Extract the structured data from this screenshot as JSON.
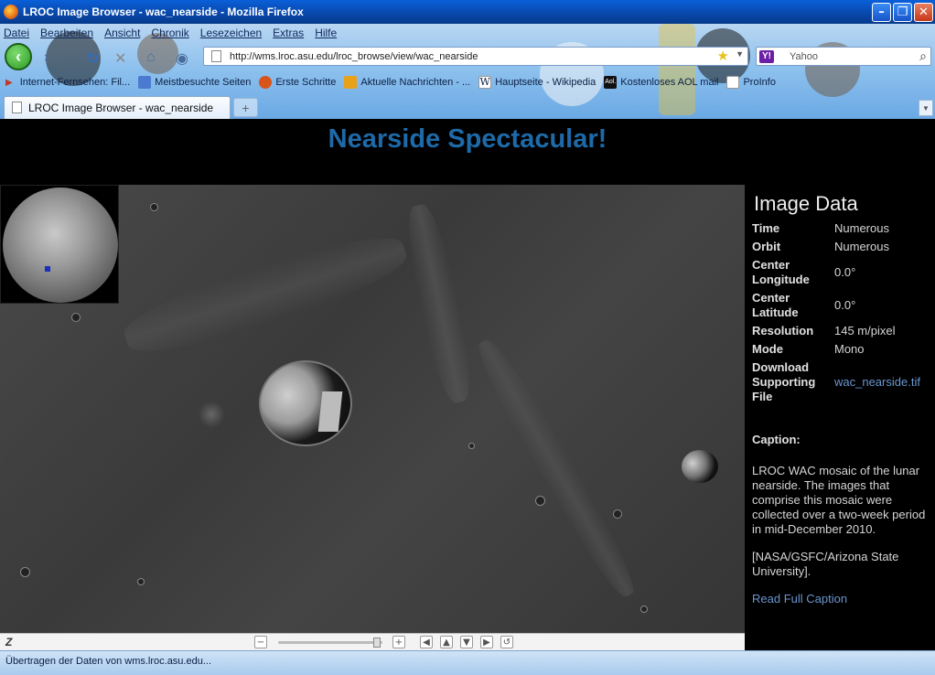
{
  "window": {
    "title": "LROC Image Browser - wac_nearside - Mozilla Firefox",
    "controls": {
      "minimize": "–",
      "maximize": "❐",
      "close": "✕"
    }
  },
  "menubar": {
    "items": [
      "Datei",
      "Bearbeiten",
      "Ansicht",
      "Chronik",
      "Lesezeichen",
      "Extras",
      "Hilfe"
    ]
  },
  "navbar": {
    "url": "http://wms.lroc.asu.edu/lroc_browse/view/wac_nearside",
    "search_engine": "Yahoo",
    "search_placeholder": "Yahoo"
  },
  "bookmarks": [
    {
      "label": "Internet-Fernsehen: Fil...",
      "icon": "tv-icon",
      "color": "#c0392b"
    },
    {
      "label": "Meistbesuchte Seiten",
      "icon": "folder-icon",
      "color": "#4a7bd0"
    },
    {
      "label": "Erste Schritte",
      "icon": "firefox-icon",
      "color": "#d9541a"
    },
    {
      "label": "Aktuelle Nachrichten - ...",
      "icon": "rss-icon",
      "color": "#e8a21a"
    },
    {
      "label": "Hauptseite - Wikipedia",
      "icon": "wikipedia-icon",
      "color": "#ffffff"
    },
    {
      "label": "Kostenloses AOL mail",
      "icon": "aol-icon",
      "color": "#111111"
    },
    {
      "label": "ProInfo",
      "icon": "page-icon",
      "color": "#ffffff"
    }
  ],
  "tabs": [
    {
      "label": "LROC Image Browser - wac_nearside",
      "active": true
    }
  ],
  "page": {
    "title": "Nearside Spectacular!",
    "panel": {
      "heading": "Image Data",
      "rows": [
        {
          "key": "Time",
          "value": "Numerous"
        },
        {
          "key": "Orbit",
          "value": "Numerous"
        },
        {
          "key": "Center Longitude",
          "value": "0.0°"
        },
        {
          "key": "Center Latitude",
          "value": "0.0°"
        },
        {
          "key": "Resolution",
          "value": "145 m/pixel"
        },
        {
          "key": "Mode",
          "value": "Mono"
        },
        {
          "key": "Download Supporting File",
          "value": "wac_nearside.tif"
        }
      ],
      "caption_heading": "Caption:",
      "caption": "LROC WAC mosaic of the lunar nearside. The images that comprise this mosaic were collected over a two-week period in mid-December 2010.",
      "credit": "[NASA/GSFC/Arizona State University].",
      "read_more": "Read Full Caption"
    },
    "map_controls": {
      "logo": "Z",
      "zoom_out": "−",
      "zoom_in": "+",
      "zoom_level": 0.95
    }
  },
  "statusbar": {
    "text": "Übertragen der Daten von wms.lroc.asu.edu..."
  },
  "colors": {
    "title_blue": "#1e6aa8",
    "link_blue": "#6a95cf",
    "page_bg": "#000000"
  }
}
